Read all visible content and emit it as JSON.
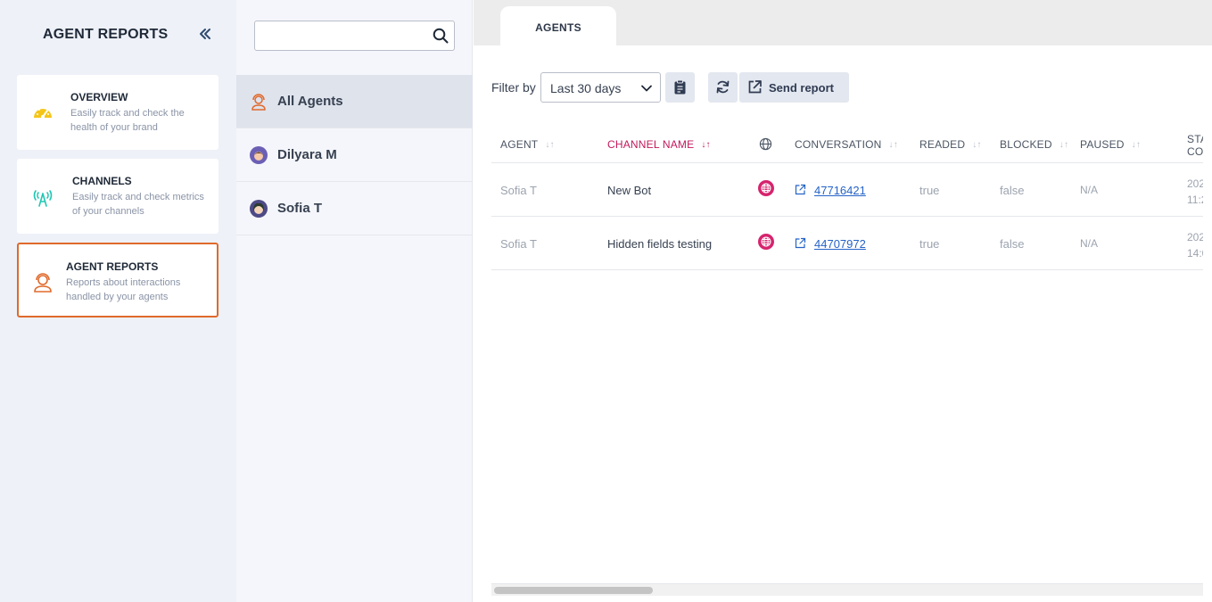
{
  "sidebar": {
    "title": "AGENT REPORTS",
    "cards": [
      {
        "title": "OVERVIEW",
        "desc": "Easily track and check the health of your brand",
        "icon": "gauge-icon"
      },
      {
        "title": "CHANNELS",
        "desc": "Easily track and check metrics of your channels",
        "icon": "broadcast-icon"
      },
      {
        "title": "AGENT REPORTS",
        "desc": "Reports about interactions handled by your agents",
        "icon": "agent-headset-icon"
      }
    ],
    "active_card": "AGENT REPORTS"
  },
  "agents_panel": {
    "search_placeholder": "",
    "items": [
      {
        "name": "All Agents",
        "selected": true
      },
      {
        "name": "Dilyara M",
        "selected": false
      },
      {
        "name": "Sofia T",
        "selected": false
      }
    ]
  },
  "main": {
    "tabs": [
      {
        "label": "AGENTS"
      }
    ],
    "filter": {
      "label": "Filter by",
      "selected": "Last 30 days"
    },
    "send_report_label": "Send report",
    "table": {
      "columns": [
        "AGENT",
        "CHANNEL NAME",
        "",
        "CONVERSATION",
        "READED",
        "BLOCKED",
        "PAUSED",
        "STA\nCO"
      ],
      "sorted_column": "CHANNEL NAME",
      "rows": [
        {
          "agent": "Sofia T",
          "channel": "New Bot",
          "conversation": "47716421",
          "readed": "true",
          "blocked": "false",
          "paused": "N/A",
          "start_1": "202",
          "start_2": "11:2"
        },
        {
          "agent": "Sofia T",
          "channel": "Hidden fields testing",
          "conversation": "44707972",
          "readed": "true",
          "blocked": "false",
          "paused": "N/A",
          "start_1": "202",
          "start_2": "14:0"
        }
      ]
    }
  },
  "colors": {
    "accent_orange": "#e06a2c",
    "sort_active": "#c2185b",
    "link": "#2563c7"
  }
}
